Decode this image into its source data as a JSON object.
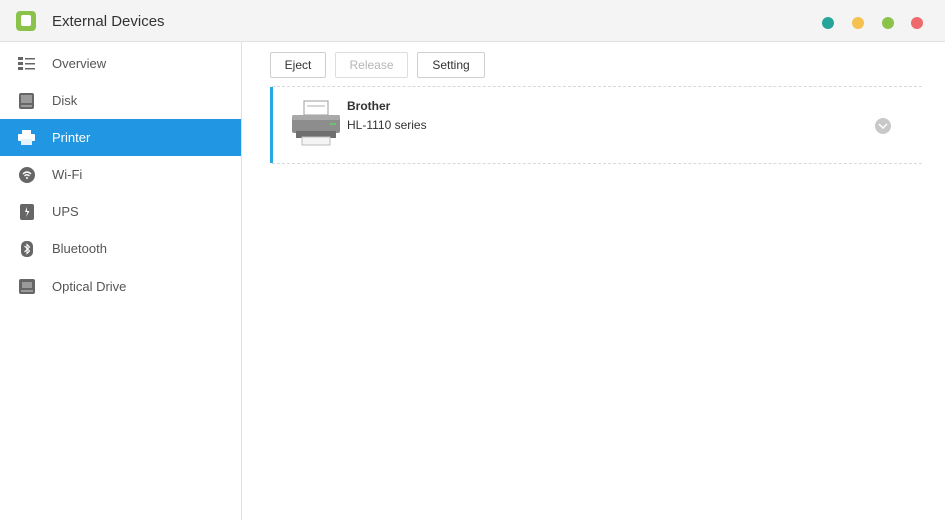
{
  "window": {
    "title": "External Devices",
    "app_icon": "external-devices-app-icon",
    "controls": [
      {
        "name": "teal-window-button",
        "color": "#26a69a"
      },
      {
        "name": "yellow-window-button",
        "color": "#f5c14f"
      },
      {
        "name": "green-window-button",
        "color": "#8bc34a"
      },
      {
        "name": "red-window-button",
        "color": "#ef6b6b"
      }
    ]
  },
  "sidebar": {
    "items": [
      {
        "label": "Overview",
        "icon": "overview-icon",
        "active": false
      },
      {
        "label": "Disk",
        "icon": "disk-icon",
        "active": false
      },
      {
        "label": "Printer",
        "icon": "printer-icon",
        "active": true
      },
      {
        "label": "Wi-Fi",
        "icon": "wifi-icon",
        "active": false
      },
      {
        "label": "UPS",
        "icon": "ups-icon",
        "active": false
      },
      {
        "label": "Bluetooth",
        "icon": "bluetooth-icon",
        "active": false
      },
      {
        "label": "Optical Drive",
        "icon": "optical-drive-icon",
        "active": false
      }
    ],
    "accent_color": "#2196e3"
  },
  "toolbar": {
    "eject_label": "Eject",
    "release_label": "Release",
    "setting_label": "Setting",
    "release_disabled": true
  },
  "devices": [
    {
      "brand": "Brother",
      "model": "HL-1110 series",
      "icon": "printer-device-icon",
      "accent_color": "#29a9e1"
    }
  ]
}
